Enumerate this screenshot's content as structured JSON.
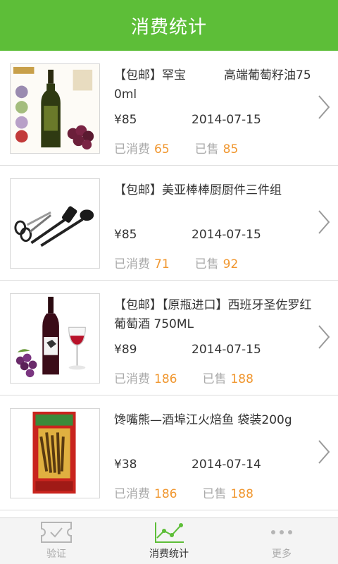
{
  "header": {
    "title": "消费统计"
  },
  "items": [
    {
      "name": "【包邮】罕宝          高端葡萄籽油750ml",
      "price": "¥85",
      "date": "2014-07-15",
      "consumed_label": "已消费",
      "consumed": "65",
      "sold_label": "已售",
      "sold": "85",
      "image": "olive-oil-bottle"
    },
    {
      "name": "【包邮】美亚棒棒厨厨件三件组",
      "price": "¥85",
      "date": "2014-07-15",
      "consumed_label": "已消费",
      "consumed": "71",
      "sold_label": "已售",
      "sold": "92",
      "image": "kitchen-tools"
    },
    {
      "name": "【包邮】【原瓶进口】西班牙圣佐罗红葡萄酒 750ML",
      "price": "¥89",
      "date": "2014-07-15",
      "consumed_label": "已消费",
      "consumed": "186",
      "sold_label": "已售",
      "sold": "188",
      "image": "red-wine-bottle"
    },
    {
      "name": "馋嘴熊—酒埠江火焙鱼 袋装200g",
      "price": "¥38",
      "date": "2014-07-14",
      "consumed_label": "已消费",
      "consumed": "186",
      "sold_label": "已售",
      "sold": "188",
      "image": "fish-snack-bag"
    }
  ],
  "tabs": [
    {
      "label": "验证",
      "icon": "ticket-check-icon"
    },
    {
      "label": "消费统计",
      "icon": "line-chart-icon",
      "active": true
    },
    {
      "label": "更多",
      "icon": "more-dots-icon"
    }
  ],
  "colors": {
    "header": "#5dbe38",
    "accent_number": "#f0962e",
    "muted_text": "#aaaaaa",
    "tab_active_icon": "#5dbe38"
  }
}
